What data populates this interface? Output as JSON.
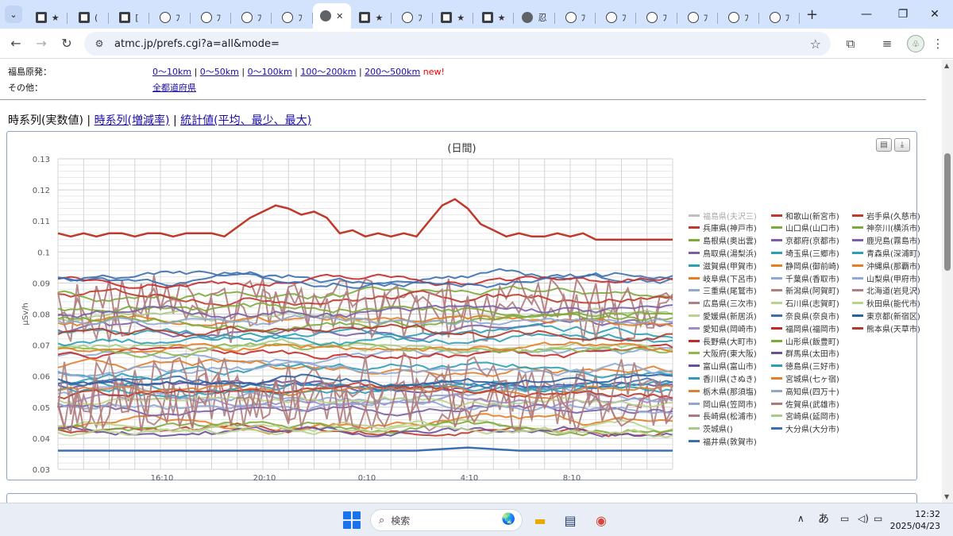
{
  "browser": {
    "tabs": [
      {
        "icon": "site-favicon",
        "glyph": "★"
      },
      {
        "icon": "site-favicon",
        "glyph": "("
      },
      {
        "icon": "site-favicon",
        "glyph": "["
      },
      {
        "icon": "page-favicon",
        "glyph": "ﾌ"
      },
      {
        "icon": "page-favicon",
        "glyph": "ﾌ"
      },
      {
        "icon": "page-favicon",
        "glyph": "ﾌ"
      },
      {
        "icon": "page-favicon",
        "glyph": "ﾌ"
      },
      {
        "icon": "globe-icon",
        "glyph": "✕",
        "active": true
      },
      {
        "icon": "site-favicon",
        "glyph": "★"
      },
      {
        "icon": "page-favicon",
        "glyph": "ﾌ"
      },
      {
        "icon": "site-favicon",
        "glyph": "★"
      },
      {
        "icon": "site-favicon",
        "glyph": "★"
      },
      {
        "icon": "globe-icon",
        "glyph": "忍"
      },
      {
        "icon": "page-favicon",
        "glyph": "ﾌ"
      },
      {
        "icon": "page-favicon",
        "glyph": "ﾌ"
      },
      {
        "icon": "page-favicon",
        "glyph": "ﾌ"
      },
      {
        "icon": "page-favicon",
        "glyph": "ﾌ"
      },
      {
        "icon": "page-favicon",
        "glyph": "ﾌ"
      },
      {
        "icon": "page-favicon",
        "glyph": "ﾌ"
      }
    ],
    "url": "atmc.jp/prefs.cgi?a=all&mode="
  },
  "page": {
    "fukushima_label": "福島原発：",
    "fukushima_links": [
      "0～10km",
      "0～50km",
      "0～100km",
      "100～200km",
      "200～500km"
    ],
    "new_badge": "new!",
    "other_label": "その他：",
    "other_link": "全都道府県",
    "view_current": "時系列(実数値)",
    "view_links": [
      "時系列(増減率)",
      "統計値(平均、最少、最大)"
    ],
    "view_sep": "|"
  },
  "chart_data": {
    "type": "line",
    "title": "(日間)",
    "ylabel": "μSv/h",
    "ylim": [
      0.03,
      0.13
    ],
    "yticks": [
      "0.03",
      "0.04",
      "0.05",
      "0.06",
      "0.07",
      "0.08",
      "0.09",
      "0.1",
      "0.11",
      "0.12",
      "0.13"
    ],
    "xticks": [
      "16:10",
      "20:10",
      "0:10",
      "4:10",
      "8:10"
    ],
    "grid": true,
    "legend_position": "right",
    "series": [
      {
        "name": "福島県(夫沢三)",
        "color": "#c0c0c0",
        "values": []
      },
      {
        "name": "兵庫県(神戸市)",
        "color": "#c0392b",
        "values": []
      },
      {
        "name": "島根県(奥出雲)",
        "color": "#7daa3a",
        "values": []
      },
      {
        "name": "鳥取県(湯梨浜)",
        "color": "#7b5ea7",
        "values": []
      },
      {
        "name": "滋賀県(甲賀市)",
        "color": "#2a9fb5",
        "values": []
      },
      {
        "name": "岐阜県(下呂市)",
        "color": "#e67e22",
        "values": []
      },
      {
        "name": "三重県(尾鷲市)",
        "color": "#8fa9d4",
        "values": []
      },
      {
        "name": "広島県(三次市)",
        "color": "#b08080",
        "values": []
      },
      {
        "name": "愛媛県(新居浜)",
        "color": "#b9d38d",
        "values": []
      },
      {
        "name": "愛知県(岡崎市)",
        "color": "#a08cc8",
        "values": []
      },
      {
        "name": "長野県(大町市)",
        "color": "#c62828",
        "values": []
      },
      {
        "name": "大阪府(東大阪)",
        "color": "#8bb94a",
        "values": []
      },
      {
        "name": "富山県(富山市)",
        "color": "#6a4e9c",
        "values": []
      },
      {
        "name": "香川県(さぬき)",
        "color": "#2e9cb8",
        "values": []
      },
      {
        "name": "栃木県(那須塩)",
        "color": "#e0802a",
        "values": []
      },
      {
        "name": "岡山県(笠岡市)",
        "color": "#90a8d0",
        "values": []
      },
      {
        "name": "長崎県(松浦市)",
        "color": "#b07878",
        "values": []
      },
      {
        "name": "茨城県()",
        "color": "#a8cc88",
        "values": []
      },
      {
        "name": "福井県(敦賀市)",
        "color": "#3a6fb0",
        "values": []
      },
      {
        "name": "和歌山(新宮市)",
        "color": "#c0392b",
        "values": []
      },
      {
        "name": "山口県(山口市)",
        "color": "#7daa3a",
        "values": []
      },
      {
        "name": "京都府(京都市)",
        "color": "#7b5ea7",
        "values": []
      },
      {
        "name": "埼玉県(三郷市)",
        "color": "#2a9fb5",
        "values": []
      },
      {
        "name": "静岡県(御前崎)",
        "color": "#e67e22",
        "values": []
      },
      {
        "name": "千葉県(香取市)",
        "color": "#8fa9d4",
        "values": []
      },
      {
        "name": "新潟県(阿賀町)",
        "color": "#b08080",
        "values": []
      },
      {
        "name": "石川県(志賀町)",
        "color": "#b9d38d",
        "values": []
      },
      {
        "name": "奈良県(奈良市)",
        "color": "#3a6fb0",
        "values": []
      },
      {
        "name": "福岡県(福岡市)",
        "color": "#c62828",
        "values": []
      },
      {
        "name": "山形県(飯豊町)",
        "color": "#7daa3a",
        "values": []
      },
      {
        "name": "群馬県(太田市)",
        "color": "#6a4e9c",
        "values": []
      },
      {
        "name": "徳島県(三好市)",
        "color": "#2e9cb8",
        "values": []
      },
      {
        "name": "宮城県(七ヶ宿)",
        "color": "#e0802a",
        "values": []
      },
      {
        "name": "高知県(四万十)",
        "color": "#90a8d0",
        "values": []
      },
      {
        "name": "佐賀県(武雄市)",
        "color": "#b07878",
        "values": []
      },
      {
        "name": "宮崎県(延岡市)",
        "color": "#a8cc88",
        "values": []
      },
      {
        "name": "大分県(大分市)",
        "color": "#3a6fb0",
        "values": []
      },
      {
        "name": "岩手県(久慈市)",
        "color": "#c0392b",
        "values": []
      },
      {
        "name": "神奈川(横浜市)",
        "color": "#7daa3a",
        "values": []
      },
      {
        "name": "鹿児島(霧島市)",
        "color": "#7b5ea7",
        "values": []
      },
      {
        "name": "青森県(深浦町)",
        "color": "#2a9fb5",
        "values": []
      },
      {
        "name": "沖縄県(那覇市)",
        "color": "#e67e22",
        "values": []
      },
      {
        "name": "山梨県(甲府市)",
        "color": "#8fa9d4",
        "values": []
      },
      {
        "name": "北海道(岩見沢)",
        "color": "#b08080",
        "values": []
      },
      {
        "name": "秋田県(能代市)",
        "color": "#b9d38d",
        "values": []
      },
      {
        "name": "東京都(新宿区)",
        "color": "#2c5f9e",
        "values": []
      },
      {
        "name": "熊本県(天草市)",
        "color": "#b03a2e",
        "values": []
      }
    ],
    "highlight_series": [
      {
        "name": "兵庫県(神戸市)",
        "x": [
          0,
          2,
          4,
          6,
          8,
          10,
          12,
          14,
          16,
          18,
          20,
          22,
          24,
          26,
          28,
          30,
          32,
          34,
          36,
          38,
          40,
          42,
          44,
          46,
          48,
          50,
          52,
          54,
          56,
          58,
          60,
          62,
          64,
          66,
          68,
          70,
          72,
          74,
          76,
          78,
          80,
          82,
          84,
          86,
          88,
          90,
          92,
          94,
          96
        ],
        "values": [
          0.106,
          0.105,
          0.106,
          0.105,
          0.106,
          0.106,
          0.105,
          0.106,
          0.106,
          0.105,
          0.106,
          0.106,
          0.106,
          0.105,
          0.108,
          0.111,
          0.113,
          0.115,
          0.114,
          0.112,
          0.113,
          0.111,
          0.106,
          0.107,
          0.105,
          0.106,
          0.105,
          0.106,
          0.105,
          0.11,
          0.115,
          0.117,
          0.114,
          0.109,
          0.107,
          0.105,
          0.106,
          0.105,
          0.105,
          0.106,
          0.105,
          0.106,
          0.104,
          0.104,
          0.104,
          0.104,
          0.104,
          0.104,
          0.104
        ]
      },
      {
        "name": "福井県(敦賀市)",
        "x": [
          0,
          8,
          16,
          24,
          32,
          40,
          48,
          56,
          64,
          72,
          80,
          88,
          96
        ],
        "values": [
          0.036,
          0.036,
          0.036,
          0.036,
          0.036,
          0.036,
          0.036,
          0.036,
          0.037,
          0.036,
          0.036,
          0.036,
          0.036
        ]
      }
    ]
  },
  "taskbar": {
    "search_placeholder": "検索",
    "ime": "あ",
    "time": "12:32",
    "date": "2025/04/23"
  }
}
